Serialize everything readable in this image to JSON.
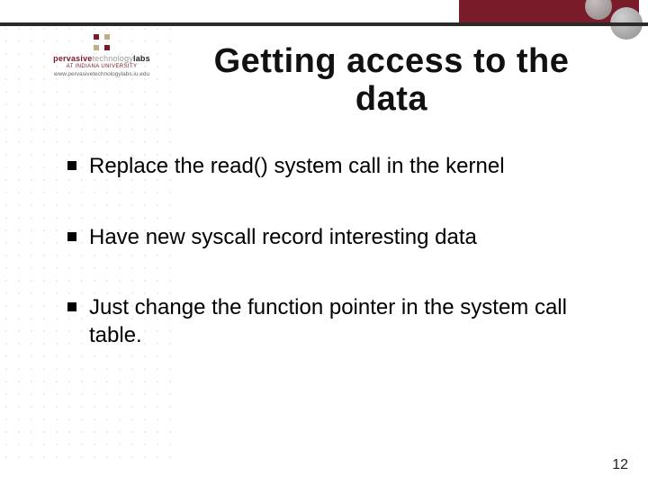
{
  "logo": {
    "brand_pervasive": "pervasive",
    "brand_technology": "technology",
    "brand_labs": "labs",
    "subline": "AT INDIANA UNIVERSITY",
    "url": "www.pervasivetechnologylabs.iu.edu"
  },
  "title": "Getting access to the data",
  "bullets": [
    "Replace the read() system call in the kernel",
    "Have new syscall record interesting data",
    "Just change the function pointer in the system call table."
  ],
  "page_number": "12"
}
